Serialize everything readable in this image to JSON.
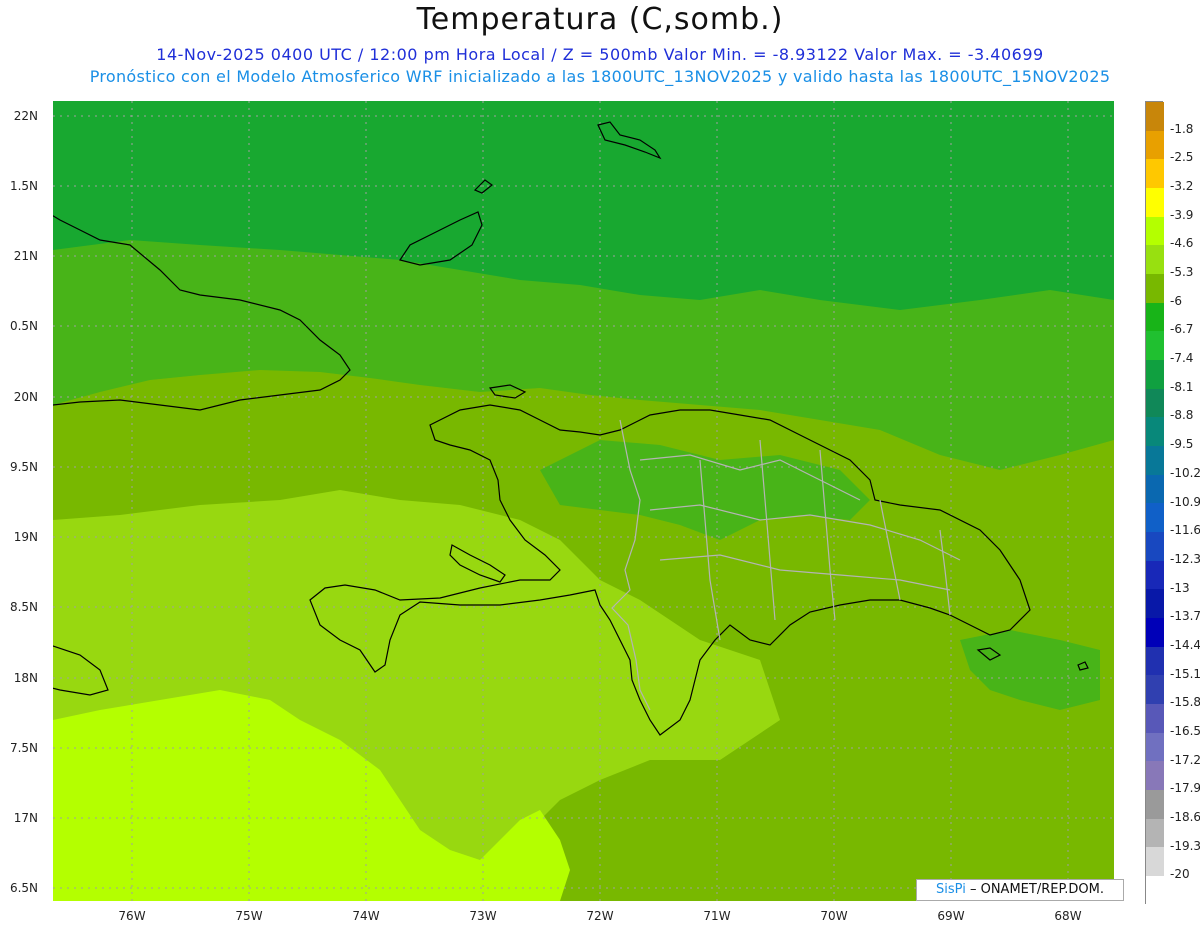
{
  "header": {
    "title": "Temperatura (C,somb.)",
    "line1": "14-Nov-2025  0400 UTC / 12:00 pm Hora Local / Z = 500mb  Valor Min. = -8.93122  Valor Max. = -3.40699",
    "line2": "Pronóstico con el Modelo Atmosferico WRF inicializado a las 1800UTC_13NOV2025 y valido hasta las  1800UTC_15NOV2025"
  },
  "axes": {
    "lat_labels": [
      "22N",
      "1.5N",
      "21N",
      "0.5N",
      "20N",
      "9.5N",
      "19N",
      "8.5N",
      "18N",
      "7.5N",
      "17N",
      "6.5N"
    ],
    "lon_labels": [
      "76W",
      "75W",
      "74W",
      "73W",
      "72W",
      "71W",
      "70W",
      "69W",
      "68W"
    ]
  },
  "colorbar": {
    "labels": [
      "-1.8",
      "-2.5",
      "-3.2",
      "-3.9",
      "-4.6",
      "-5.3",
      "-6",
      "-6.7",
      "-7.4",
      "-8.1",
      "-8.8",
      "-9.5",
      "-10.2",
      "-10.9",
      "-11.6",
      "-12.3",
      "-13",
      "-13.7",
      "-14.4",
      "-15.1",
      "-15.8",
      "-16.5",
      "-17.2",
      "-17.9",
      "-18.6",
      "-19.3",
      "-20"
    ],
    "colors": [
      "#c8860a",
      "#e8a000",
      "#ffc800",
      "#ffff00",
      "#b4ff00",
      "#98e010",
      "#78b800",
      "#18b418",
      "#20c030",
      "#10a040",
      "#108858",
      "#08887a",
      "#087898",
      "#0a68b0",
      "#1060c8",
      "#1848c0",
      "#1828b8",
      "#0818a8",
      "#0000b8",
      "#2030b0",
      "#3040b0",
      "#5858b8",
      "#7070c0",
      "#8878b8",
      "#9a9a9a",
      "#b4b4b4",
      "#d8d8d8"
    ]
  },
  "credit": {
    "brand": "SisPi",
    "rest": " – ONAMET/REP.DOM."
  },
  "map_colors": {
    "deep_green": "#18a830",
    "green": "#48b418",
    "olive": "#78b800",
    "light": "#98d810",
    "lime": "#b4ff00",
    "coast": "#000000",
    "border": "#b4b4b4"
  }
}
